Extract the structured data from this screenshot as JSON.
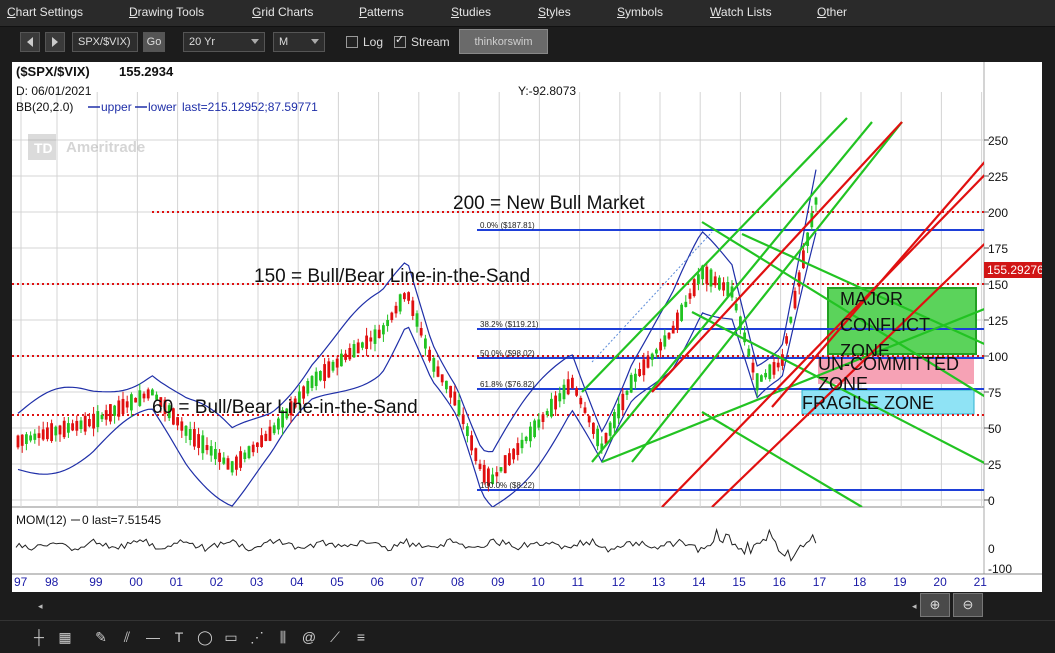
{
  "menu": [
    "Chart Settings",
    "Drawing Tools",
    "Grid Charts",
    "Patterns",
    "Studies",
    "Styles",
    "Symbols",
    "Watch Lists",
    "Other"
  ],
  "toolbar": {
    "symbol": "SPX/$VIX)",
    "go": "Go",
    "period": "20 Yr",
    "aggregation": "M",
    "log_label": "Log",
    "stream_label": "Stream",
    "brand": "thinkorswim"
  },
  "chart": {
    "header_symbol": "($SPX/$VIX)",
    "header_price": "155.2934",
    "date_line": "D: 06/01/2021",
    "y_readout": "Y:-92.8073",
    "bb_label": "BB(20,2.0)",
    "bb_upper": "upper",
    "bb_lower": "lower",
    "bb_last": "last=215.12952;87.59771",
    "watermark": "Ameritrade",
    "price_tag": "155.29276",
    "mom_label": "MOM(12)",
    "mom_zero": "0",
    "mom_last": "last=7.51545",
    "colors": {
      "bull": "#22c322",
      "bear": "#e01010",
      "price_tag": "#d11616",
      "zone_green": "#5bd35b",
      "zone_pink": "#f6a2b5",
      "zone_cyan": "#8fe3f5",
      "fib": "#1e3fd8",
      "bb": "#1f2fa8"
    }
  },
  "annotations": {
    "bull_market": "200 = New Bull Market",
    "line_150": "150 = Bull/Bear Line-in-the-Sand",
    "line_60": "60 = Bull/Bear Line-in-the-Sand",
    "major": "MAJOR CONFLICT ZONE",
    "uncommitted": "UN-COMMITTED ZONE",
    "fragile": "FRAGILE ZONE"
  },
  "fib_labels": [
    "0.0% ($187.81)",
    "38.2% ($119.21)",
    "50.0% ($98.02)",
    "61.8% ($76.82)",
    "100.0% ($8.22)"
  ],
  "y_ticks": [
    "250",
    "225",
    "200",
    "175",
    "150",
    "125",
    "100",
    "75",
    "50",
    "25",
    "0"
  ],
  "mom_ticks": [
    "0",
    "-100"
  ],
  "x_ticks": [
    "97",
    "98",
    "99",
    "00",
    "01",
    "02",
    "03",
    "04",
    "05",
    "06",
    "07",
    "08",
    "09",
    "10",
    "11",
    "12",
    "13",
    "14",
    "15",
    "16",
    "17",
    "18",
    "19",
    "20",
    "21"
  ]
}
